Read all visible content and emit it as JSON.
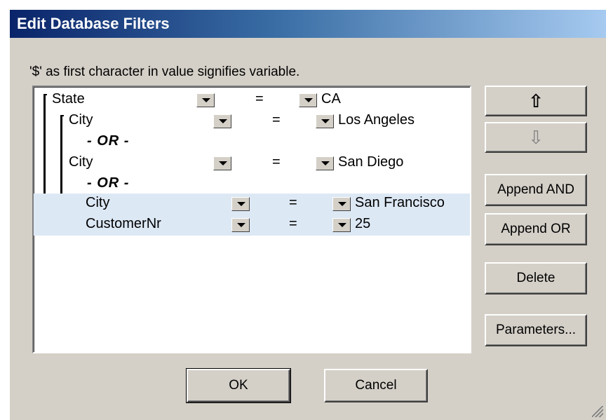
{
  "window": {
    "title": "Edit Database Filters"
  },
  "hint": "'$' as first character in value signifies variable.",
  "filters": [
    {
      "field": "State",
      "op": "=",
      "value": "CA"
    },
    {
      "field": "City",
      "op": "=",
      "value": "Los Angeles"
    },
    {
      "or_label": "- OR -"
    },
    {
      "field": "City",
      "op": "=",
      "value": "San Diego"
    },
    {
      "or_label": "- OR -"
    },
    {
      "field": "City",
      "op": "=",
      "value": "San Francisco",
      "selected": true
    },
    {
      "field": "CustomerNr",
      "op": "=",
      "value": "25",
      "selected": true
    }
  ],
  "buttons": {
    "move_up": "⇧",
    "move_down": "⇩",
    "append_and": "Append AND",
    "append_or": "Append OR",
    "delete": "Delete",
    "parameters": "Parameters...",
    "ok": "OK",
    "cancel": "Cancel"
  },
  "colors": {
    "title_start": "#0a246a",
    "title_end": "#a6caf0",
    "selection": "#dde8f5",
    "face": "#d4d0c8"
  }
}
